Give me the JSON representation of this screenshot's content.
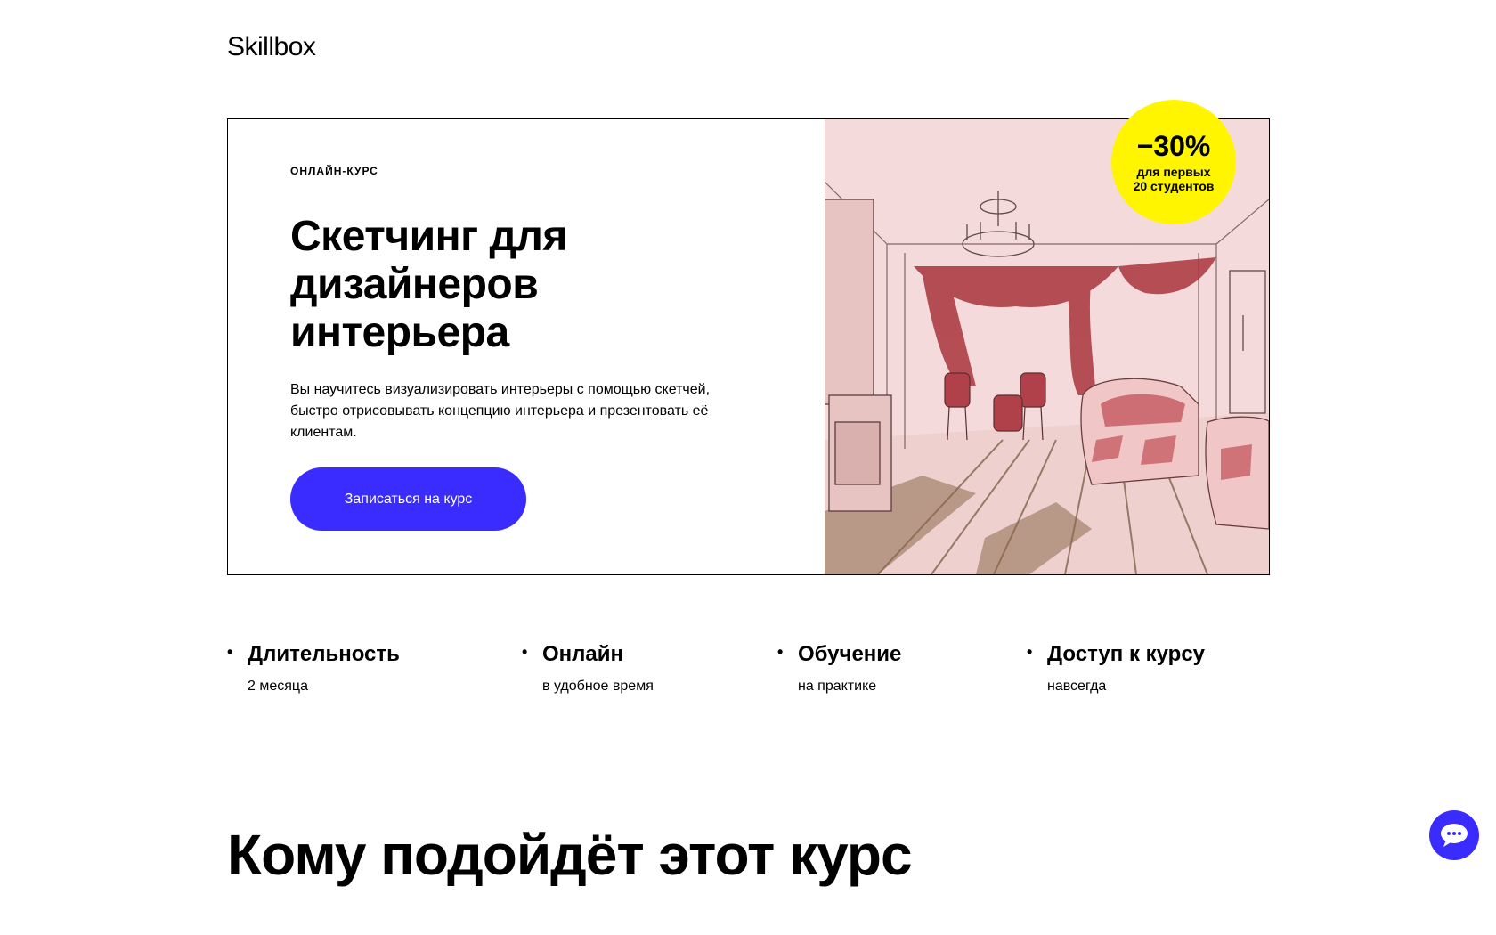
{
  "header": {
    "logo": "Skillbox"
  },
  "hero": {
    "tag": "ОНЛАЙН-КУРС",
    "title": "Скетчинг для дизайнеров интерьера",
    "description": "Вы научитесь визуализировать интерьеры с помощью скетчей, быстро отрисовывать концепцию интерьера и презентовать её клиентам.",
    "cta_label": "Записаться на курс",
    "badge": {
      "percent": "−30%",
      "line1": "для первых",
      "line2": "20 студентов"
    }
  },
  "features": [
    {
      "title": "Длительность",
      "subtitle": "2 месяца"
    },
    {
      "title": "Онлайн",
      "subtitle": "в удобное время"
    },
    {
      "title": "Обучение",
      "subtitle": "на практике"
    },
    {
      "title": "Доступ к курсу",
      "subtitle": "навсегда"
    }
  ],
  "section": {
    "title": "Кому подойдёт этот курс"
  },
  "colors": {
    "accent": "#3a2bff",
    "badge": "#fff500"
  },
  "icons": {
    "chat": "chat-icon"
  }
}
